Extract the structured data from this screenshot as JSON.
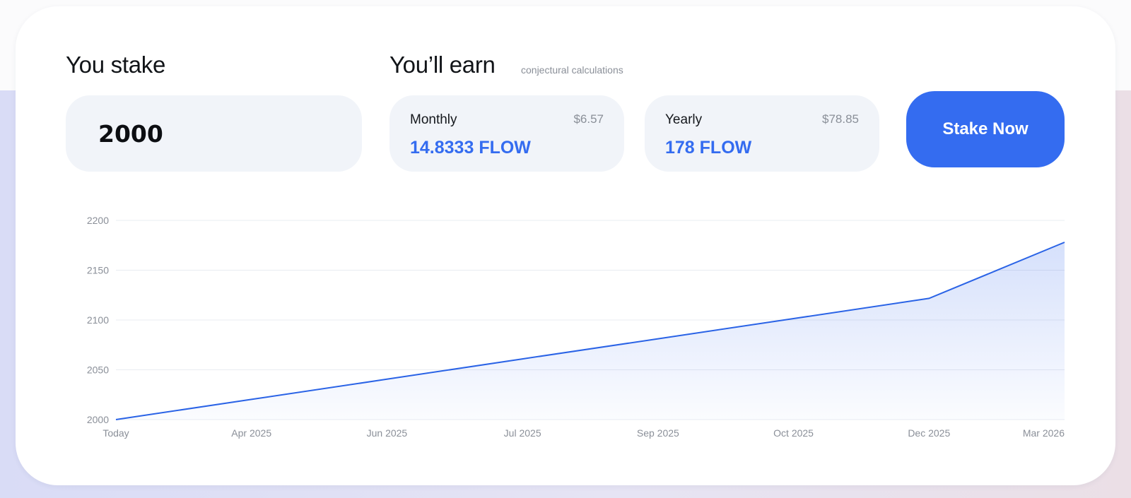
{
  "stake": {
    "heading": "You stake",
    "amount": "2000"
  },
  "earn": {
    "heading": "You’ll earn",
    "note": "conjectural calculations",
    "monthly": {
      "label": "Monthly",
      "usd": "$6.57",
      "flow": "14.8333 FLOW"
    },
    "yearly": {
      "label": "Yearly",
      "usd": "$78.85",
      "flow": "178 FLOW"
    }
  },
  "actions": {
    "stake_now_label": "Stake Now"
  },
  "colors": {
    "accent": "#346cf0",
    "box_bg": "#f1f4f9",
    "line": "#2a63e6"
  },
  "chart_data": {
    "type": "area",
    "categories": [
      "Today",
      "Apr 2025",
      "Jun 2025",
      "Jul 2025",
      "Sep 2025",
      "Oct 2025",
      "Dec 2025",
      "Mar 2026"
    ],
    "series": [
      {
        "values": [
          2000,
          2020.3,
          2040.6,
          2060.9,
          2081.1,
          2101.4,
          2121.7,
          2178
        ]
      }
    ],
    "yticks": [
      2000,
      2050,
      2100,
      2150,
      2200
    ],
    "ylim": [
      2000,
      2200
    ],
    "grid": true,
    "legend": "none"
  }
}
